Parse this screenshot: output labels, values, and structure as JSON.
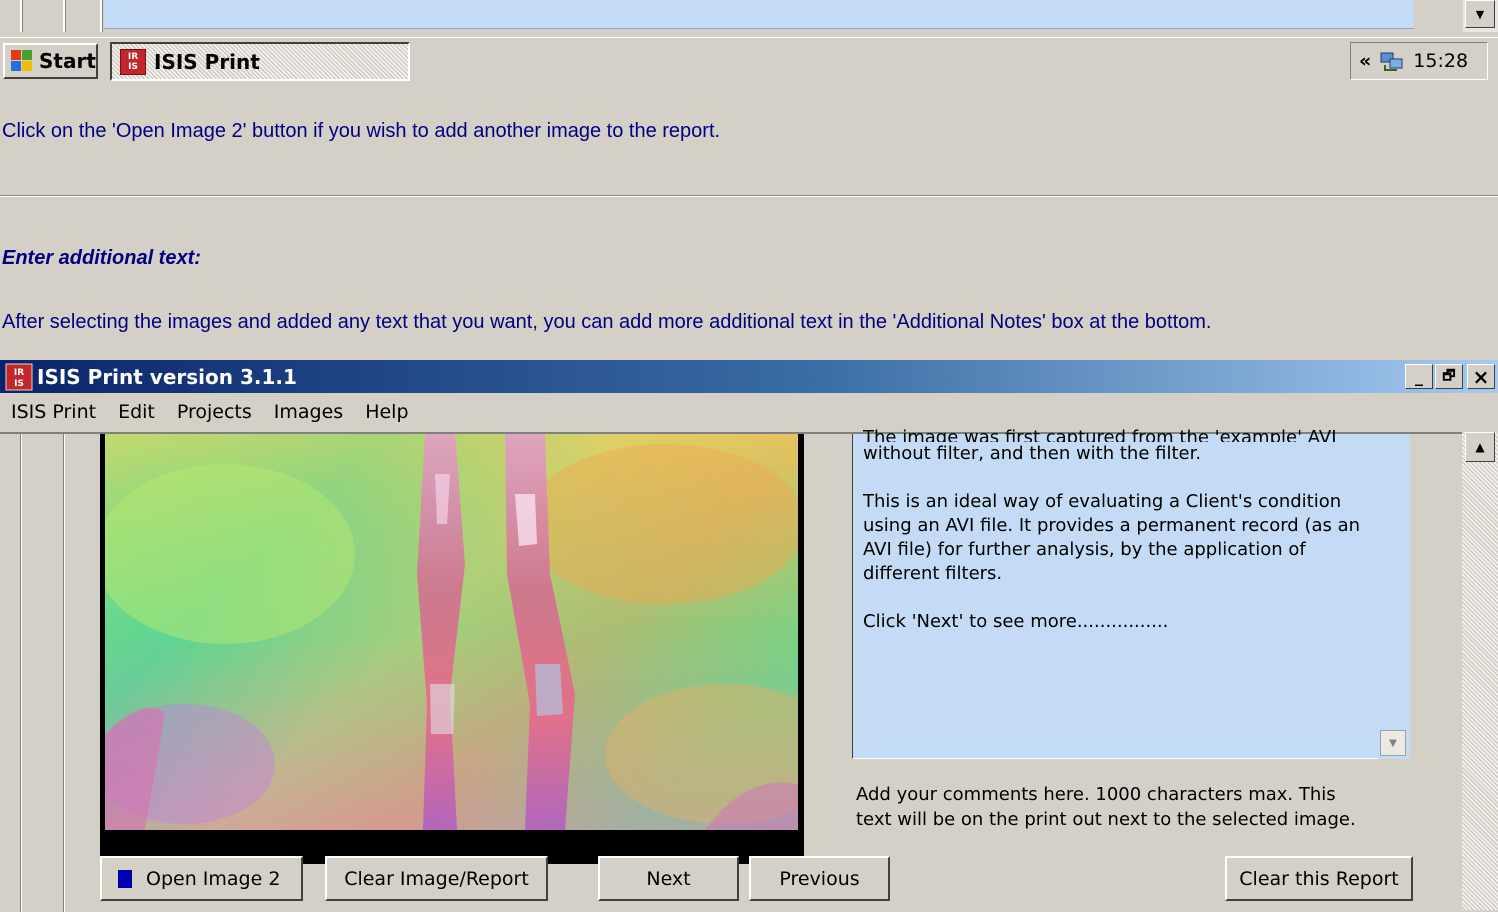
{
  "taskbar": {
    "start_label": "Start",
    "task_label": "ISIS Print",
    "tray_chevron": "«",
    "clock": "15:28"
  },
  "doc": {
    "para1": "Click on the 'Open Image 2' button if you wish to add another image to the report.",
    "heading": "Enter additional text:",
    "para2": "After selecting the images and added any text that you want, you can add more additional text in the 'Additional Notes' box at the bottom."
  },
  "window": {
    "title": "ISIS Print version 3.1.1",
    "icon_text": "IRIS",
    "minimize": "_",
    "restore": "🗗",
    "close": "×"
  },
  "menu": [
    {
      "label": "ISIS Print"
    },
    {
      "label": "Edit"
    },
    {
      "label": "Projects"
    },
    {
      "label": "Images"
    },
    {
      "label": "Help"
    }
  ],
  "notes": {
    "line_cut": "The image was first captured from the 'example' AVI file,",
    "p1": "without filter, and then with the filter.",
    "p2": "This is an ideal way of evaluating a Client's condition using an AVI file. It provides a permanent record (as an AVI file) for further analysis, by the application of different filters.",
    "p3": "Click 'Next' to see more................"
  },
  "comment_hint": "Add your comments here.  1000 characters max. This text will be on the print out next to the selected image.",
  "buttons": {
    "open_image_2": "Open Image 2",
    "clear_image_report": "Clear Image/Report",
    "next": "Next",
    "previous": "Previous",
    "clear_this_report": "Clear this Report"
  },
  "icons": {
    "start": "windows-flag-icon",
    "app": "isis-print-icon",
    "tray": "network-icon",
    "scroll_up": "arrow-up-icon",
    "scroll_down": "arrow-down-icon"
  },
  "colors": {
    "title_bar_start": "#0a246a",
    "title_bar_end": "#a6caf0",
    "notes_background": "#c3dbf5",
    "doc_text": "#000080",
    "open_image_marker": "#0000b0"
  }
}
